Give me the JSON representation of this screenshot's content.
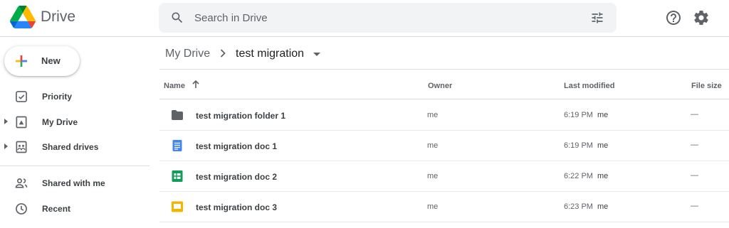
{
  "header": {
    "app_name": "Drive",
    "search_placeholder": "Search in Drive"
  },
  "sidebar": {
    "new_label": "New",
    "items": [
      {
        "label": "Priority",
        "icon": "priority-icon",
        "expandable": false
      },
      {
        "label": "My Drive",
        "icon": "my-drive-icon",
        "expandable": true
      },
      {
        "label": "Shared drives",
        "icon": "shared-drives-icon",
        "expandable": true
      },
      {
        "label": "Shared with me",
        "icon": "shared-with-me-icon",
        "expandable": false
      },
      {
        "label": "Recent",
        "icon": "recent-icon",
        "expandable": false
      }
    ]
  },
  "breadcrumb": {
    "root": "My Drive",
    "current": "test migration"
  },
  "table": {
    "columns": [
      "Name",
      "Owner",
      "Last modified",
      "File size"
    ],
    "rows": [
      {
        "name": "test migration folder 1",
        "type": "folder",
        "owner": "me",
        "modified_time": "6:19 PM",
        "modified_by": "me",
        "size": "—"
      },
      {
        "name": "test migration doc 1",
        "type": "docs",
        "owner": "me",
        "modified_time": "6:19 PM",
        "modified_by": "me",
        "size": "—"
      },
      {
        "name": "test migration doc 2",
        "type": "sheets",
        "owner": "me",
        "modified_time": "6:22 PM",
        "modified_by": "me",
        "size": "—"
      },
      {
        "name": "test migration doc 3",
        "type": "slides",
        "owner": "me",
        "modified_time": "6:23 PM",
        "modified_by": "me",
        "size": "—"
      }
    ]
  },
  "colors": {
    "text_primary": "#202124",
    "text_secondary": "#5f6368",
    "search_bg": "#f1f3f4",
    "divider": "#dadce0",
    "docs_blue": "#4285f4",
    "sheets_green": "#0f9d58",
    "slides_yellow": "#f4b400",
    "folder_gray": "#5f6368"
  }
}
